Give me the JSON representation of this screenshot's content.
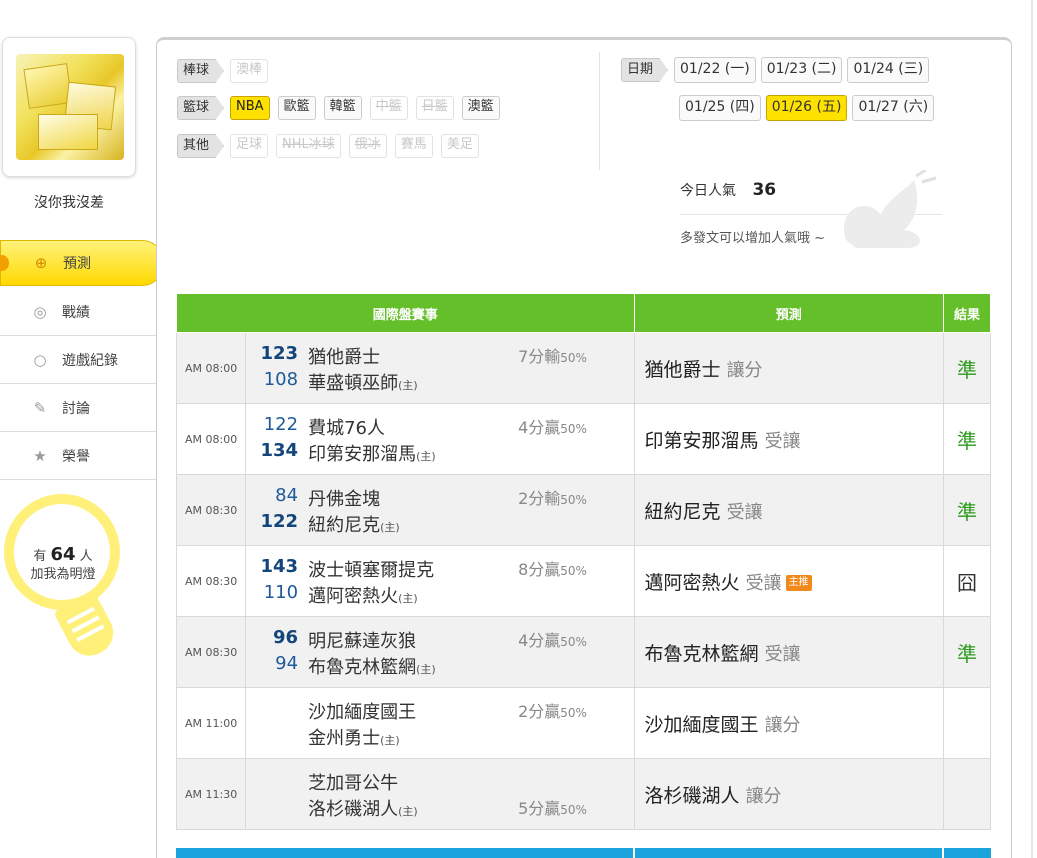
{
  "user": {
    "name": "沒你我沒差"
  },
  "menu": [
    {
      "label": "預測",
      "icon": "target-icon",
      "active": true
    },
    {
      "label": "戰績",
      "icon": "record-icon",
      "active": false
    },
    {
      "label": "遊戲紀錄",
      "icon": "ring-icon",
      "active": false
    },
    {
      "label": "討論",
      "icon": "chat-icon",
      "active": false
    },
    {
      "label": "榮譽",
      "icon": "medal-icon",
      "active": false
    }
  ],
  "fans": {
    "prefix": "有",
    "count": "64",
    "suffix": "人",
    "line2": "加我為明燈"
  },
  "filters": {
    "baseball": {
      "label": "棒球",
      "options": [
        {
          "label": "澳棒",
          "state": "disabled"
        }
      ]
    },
    "basketball": {
      "label": "籃球",
      "options": [
        {
          "label": "NBA",
          "state": "selected"
        },
        {
          "label": "歐籃",
          "state": "normal"
        },
        {
          "label": "韓籃",
          "state": "normal"
        },
        {
          "label": "中籃",
          "state": "strike"
        },
        {
          "label": "日籃",
          "state": "strike"
        },
        {
          "label": "澳籃",
          "state": "normal"
        }
      ]
    },
    "other": {
      "label": "其他",
      "options": [
        {
          "label": "足球",
          "state": "disabled"
        },
        {
          "label": "NHL冰球",
          "state": "strike"
        },
        {
          "label": "俄冰",
          "state": "strike"
        },
        {
          "label": "賽馬",
          "state": "disabled"
        },
        {
          "label": "美足",
          "state": "disabled"
        }
      ]
    }
  },
  "dates": {
    "label": "日期",
    "row1": [
      {
        "label": "01/22 (一)",
        "selected": false
      },
      {
        "label": "01/23 (二)",
        "selected": false
      },
      {
        "label": "01/24 (三)",
        "selected": false
      }
    ],
    "row2": [
      {
        "label": "01/25 (四)",
        "selected": false
      },
      {
        "label": "01/26 (五)",
        "selected": true
      },
      {
        "label": "01/27 (六)",
        "selected": false
      }
    ]
  },
  "popularity": {
    "label": "今日人氣",
    "value": "36",
    "tip": "多發文可以增加人氣哦 ~"
  },
  "table": {
    "headers": {
      "match": "國際盤賽事",
      "prediction": "預測",
      "result": "結果"
    },
    "home_mark": "(主)",
    "rows": [
      {
        "time": "AM 08:00",
        "away": {
          "score": "123",
          "team": "猶他爵士",
          "win": true
        },
        "home": {
          "score": "108",
          "team": "華盛頓巫師",
          "win": false
        },
        "handicap": {
          "text": "7分輸",
          "pct": "50%",
          "line": 1
        },
        "pred_team": "猶他爵士",
        "pred_type": "讓分",
        "main_tag": "",
        "result": "準",
        "result_kind": "ok"
      },
      {
        "time": "AM 08:00",
        "away": {
          "score": "122",
          "team": "費城76人",
          "win": false
        },
        "home": {
          "score": "134",
          "team": "印第安那溜馬",
          "win": true
        },
        "handicap": {
          "text": "4分贏",
          "pct": "50%",
          "line": 1
        },
        "pred_team": "印第安那溜馬",
        "pred_type": "受讓",
        "main_tag": "",
        "result": "準",
        "result_kind": "ok"
      },
      {
        "time": "AM 08:30",
        "away": {
          "score": "84",
          "team": "丹佛金塊",
          "win": false
        },
        "home": {
          "score": "122",
          "team": "紐約尼克",
          "win": true
        },
        "handicap": {
          "text": "2分輸",
          "pct": "50%",
          "line": 1
        },
        "pred_team": "紐約尼克",
        "pred_type": "受讓",
        "main_tag": "",
        "result": "準",
        "result_kind": "ok"
      },
      {
        "time": "AM 08:30",
        "away": {
          "score": "143",
          "team": "波士頓塞爾提克",
          "win": true
        },
        "home": {
          "score": "110",
          "team": "邁阿密熱火",
          "win": false
        },
        "handicap": {
          "text": "8分贏",
          "pct": "50%",
          "line": 1
        },
        "pred_team": "邁阿密熱火",
        "pred_type": "受讓",
        "main_tag": "主推",
        "result": "囧",
        "result_kind": "bad"
      },
      {
        "time": "AM 08:30",
        "away": {
          "score": "96",
          "team": "明尼蘇達灰狼",
          "win": true
        },
        "home": {
          "score": "94",
          "team": "布魯克林籃網",
          "win": false
        },
        "handicap": {
          "text": "4分贏",
          "pct": "50%",
          "line": 1
        },
        "pred_team": "布魯克林籃網",
        "pred_type": "受讓",
        "main_tag": "",
        "result": "準",
        "result_kind": "ok"
      },
      {
        "time": "AM 11:00",
        "away": {
          "score": "",
          "team": "沙加緬度國王",
          "win": false
        },
        "home": {
          "score": "",
          "team": "金州勇士",
          "win": false
        },
        "handicap": {
          "text": "2分贏",
          "pct": "50%",
          "line": 1
        },
        "pred_team": "沙加緬度國王",
        "pred_type": "讓分",
        "main_tag": "",
        "result": "",
        "result_kind": "none"
      },
      {
        "time": "AM 11:30",
        "away": {
          "score": "",
          "team": "芝加哥公牛",
          "win": false
        },
        "home": {
          "score": "",
          "team": "洛杉磯湖人",
          "win": false
        },
        "handicap": {
          "text": "5分贏",
          "pct": "50%",
          "line": 2
        },
        "pred_team": "洛杉磯湖人",
        "pred_type": "讓分",
        "main_tag": "",
        "result": "",
        "result_kind": "none"
      }
    ]
  }
}
